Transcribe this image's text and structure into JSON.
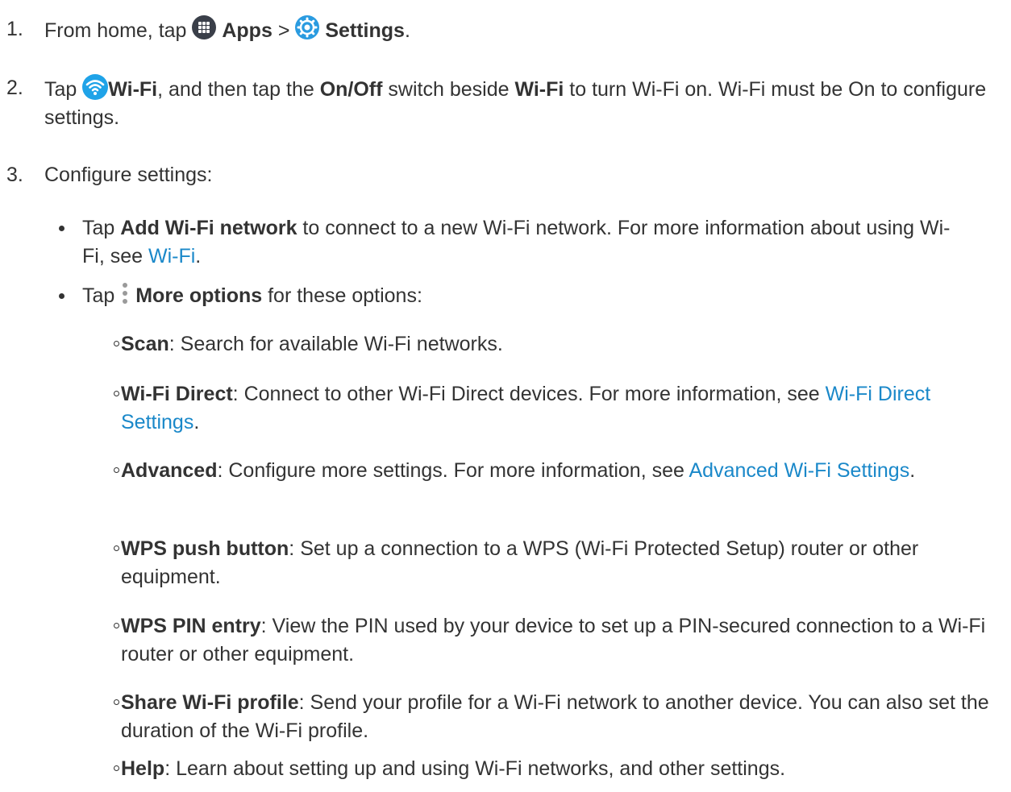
{
  "steps": [
    {
      "number": "1.",
      "t1": "From home, tap",
      "apps": "Apps",
      "sep": ">",
      "settings": "Settings",
      "end": "."
    },
    {
      "number": "2.",
      "t1": "Tap",
      "wifi": "Wi-Fi",
      "t2": ", and then tap the",
      "onoff": "On/Off",
      "t3": "switch beside",
      "wifi2": "Wi-Fi",
      "t4": "to turn Wi-Fi on. Wi-Fi must be On to configure settings."
    },
    {
      "number": "3.",
      "t1": "Configure settings:"
    }
  ],
  "bullets": [
    {
      "t1": "Tap",
      "bold": "Add Wi-Fi network",
      "t2": "to connect to a new Wi-Fi network. For more information about using Wi-Fi, see",
      "link": "Wi-Fi",
      "end": "."
    },
    {
      "t1": "Tap",
      "bold": "More options",
      "t2": "for these options:"
    }
  ],
  "options": [
    {
      "term": "Scan",
      "desc": ": Search for available Wi-Fi networks."
    },
    {
      "term": "Wi-Fi Direct",
      "desc": ": Connect to other Wi-Fi Direct devices. For more information, see",
      "link": "Wi-Fi Direct Settings",
      "end": "."
    },
    {
      "term": "Advanced",
      "desc": ": Configure more settings. For more information, see",
      "link": "Advanced Wi-Fi Settings",
      "end": "."
    },
    {
      "term": "WPS push button",
      "desc": ": Set up a connection to a WPS (Wi-Fi Protected Setup) router or other equipment."
    },
    {
      "term": "WPS PIN entry",
      "desc": ": View the PIN used by your device to set up a PIN-secured connection to a Wi-Fi router or other equipment."
    },
    {
      "term": "Share Wi-Fi profile",
      "desc": ": Send your profile for a Wi-Fi network to another device. You can also set the duration of the Wi-Fi profile."
    },
    {
      "term": "Help",
      "desc": ": Learn about setting up and using Wi-Fi networks, and other settings."
    }
  ],
  "icons": {
    "apps": "apps-icon",
    "settings": "settings-icon",
    "wifi": "wifi-icon",
    "more": "more-options-icon"
  },
  "colors": {
    "text": "#333333",
    "link": "#1a88c9",
    "settings_icon": "#2a9be0",
    "wifi_icon": "#1fa3e8",
    "apps_icon": "#3a3f49"
  }
}
